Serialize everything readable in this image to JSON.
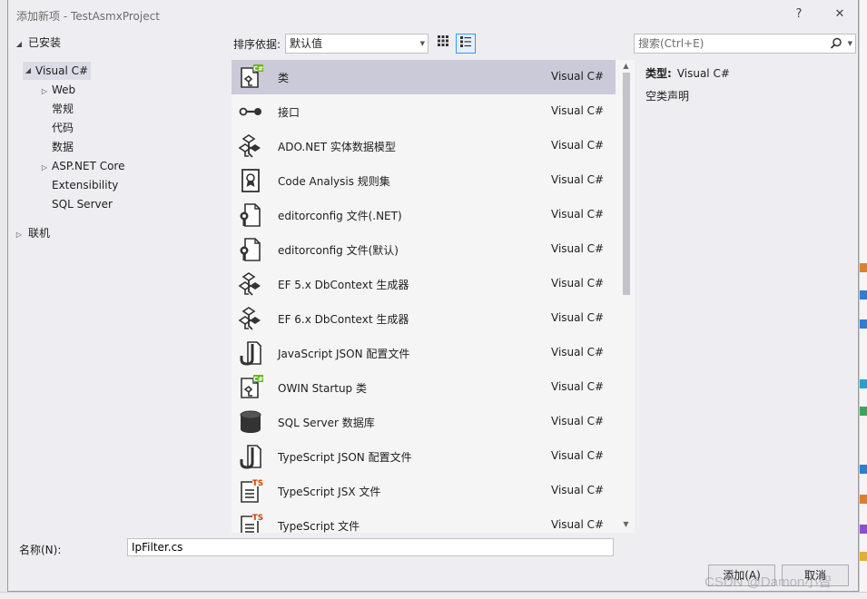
{
  "dialog": {
    "title": "添加新项 - TestAsmxProject",
    "help_label": "?",
    "close_label": "✕"
  },
  "tree": {
    "installed_label": "已安装",
    "visual_csharp_label": "Visual C#",
    "children": [
      "Web",
      "常规",
      "代码",
      "数据",
      "ASP.NET Core",
      "Extensibility",
      "SQL Server"
    ],
    "online_label": "联机"
  },
  "toolbar": {
    "sort_label": "排序依据:",
    "sort_value": "默认值",
    "search_placeholder": "搜索(Ctrl+E)"
  },
  "templates": [
    {
      "name": "类",
      "lang": "Visual C#",
      "icon": "class-icon"
    },
    {
      "name": "接口",
      "lang": "Visual C#",
      "icon": "interface-icon"
    },
    {
      "name": "ADO.NET 实体数据模型",
      "lang": "Visual C#",
      "icon": "entity-model-icon"
    },
    {
      "name": "Code Analysis 规则集",
      "lang": "Visual C#",
      "icon": "ruleset-icon"
    },
    {
      "name": "editorconfig 文件(.NET)",
      "lang": "Visual C#",
      "icon": "editorconfig-icon"
    },
    {
      "name": "editorconfig 文件(默认)",
      "lang": "Visual C#",
      "icon": "editorconfig-icon"
    },
    {
      "name": "EF 5.x DbContext 生成器",
      "lang": "Visual C#",
      "icon": "entity-model-icon"
    },
    {
      "name": "EF 6.x DbContext 生成器",
      "lang": "Visual C#",
      "icon": "entity-model-icon"
    },
    {
      "name": "JavaScript JSON 配置文件",
      "lang": "Visual C#",
      "icon": "json-config-icon"
    },
    {
      "name": "OWIN Startup 类",
      "lang": "Visual C#",
      "icon": "class-icon"
    },
    {
      "name": "SQL Server 数据库",
      "lang": "Visual C#",
      "icon": "database-icon"
    },
    {
      "name": "TypeScript JSON 配置文件",
      "lang": "Visual C#",
      "icon": "json-config-icon"
    },
    {
      "name": "TypeScript JSX 文件",
      "lang": "Visual C#",
      "icon": "typescript-file-icon"
    },
    {
      "name": "TypeScript 文件",
      "lang": "Visual C#",
      "icon": "typescript-file-icon"
    }
  ],
  "details": {
    "type_label": "类型:",
    "type_value": "Visual C#",
    "description": "空类声明"
  },
  "footer": {
    "name_label": "名称(N):",
    "name_value": "IpFilter.cs",
    "add_label": "添加(A)",
    "cancel_label": "取消"
  },
  "watermark": "CSDN @Damon小智",
  "colors": {
    "selection": "#cacad8",
    "accent": "#3399ff",
    "csharp_green": "#68b723",
    "typescript_orange": "#d44000"
  }
}
